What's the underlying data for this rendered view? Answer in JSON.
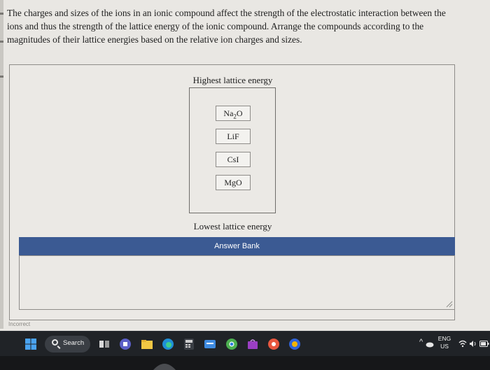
{
  "question": {
    "text": "The charges and sizes of the ions in an ionic compound affect the strength of the electrostatic interaction between the ions and thus the strength of the lattice energy of the ionic compound. Arrange the compounds according to the magnitudes of their lattice energies based on the relative ion charges and sizes."
  },
  "ranking": {
    "highest_label": "Highest lattice energy",
    "lowest_label": "Lowest lattice energy",
    "items": [
      {
        "formula_main": "Na",
        "formula_sub": "2",
        "formula_tail": "O"
      },
      {
        "formula": "LiF"
      },
      {
        "formula": "CsI"
      },
      {
        "formula": "MgO"
      }
    ]
  },
  "answer_bank": {
    "title": "Answer Bank"
  },
  "status": {
    "result": "Incorrect"
  },
  "taskbar": {
    "search_label": "Search",
    "language": "ENG",
    "region": "US",
    "tray_expand": "^",
    "icons": [
      "windows-start-icon",
      "search-icon",
      "task-view-icon",
      "teams-icon",
      "file-explorer-icon",
      "edge-icon",
      "calculator-icon",
      "app-icon",
      "chrome-icon",
      "store-icon",
      "media-icon",
      "browser-icon"
    ]
  },
  "colors": {
    "answer_bar": "#3b5a93",
    "taskbar": "#202327",
    "background": "#e9e7e3"
  }
}
